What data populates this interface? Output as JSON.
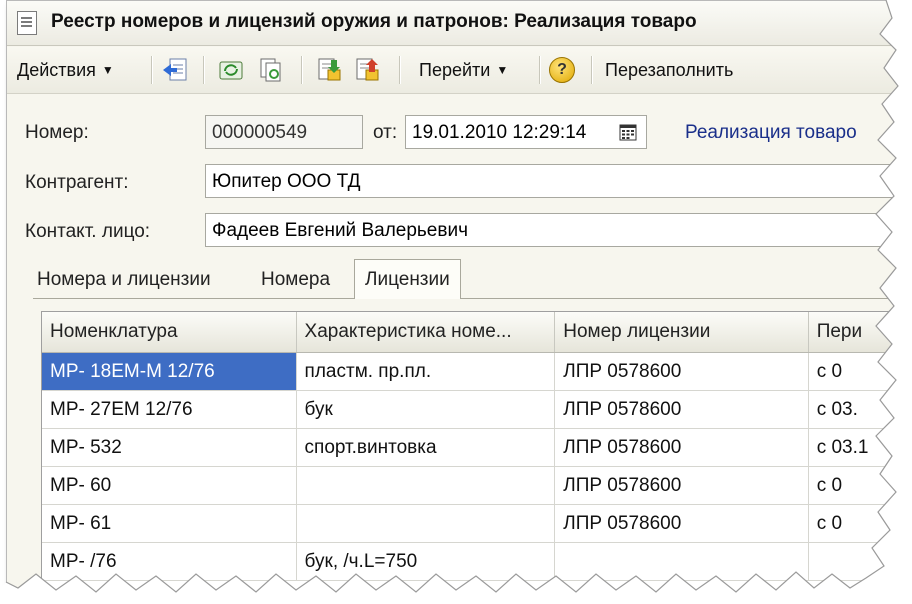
{
  "window": {
    "title": "Реестр номеров и лицензий оружия и патронов: Реализация товаро"
  },
  "toolbar": {
    "actions_label": "Действия",
    "goto_label": "Перейти",
    "refill_label": "Перезаполнить"
  },
  "form": {
    "number_label": "Номер:",
    "number_value": "000000549",
    "from_label": "от:",
    "date_value": "19.01.2010 12:29:14",
    "basis_link": "Реализация товаро",
    "counterparty_label": "Контрагент:",
    "counterparty_value": "Юпитер ООО ТД",
    "contact_label": "Контакт. лицо:",
    "contact_value": "Фадеев Евгений Валерьевич"
  },
  "tabs": [
    {
      "label": "Номера и лицензии"
    },
    {
      "label": "Номера"
    },
    {
      "label": "Лицензии"
    }
  ],
  "active_tab": "Лицензии",
  "table": {
    "columns": [
      "Номенклатура",
      "Характеристика номе...",
      "Номер лицензии",
      "Пери"
    ],
    "rows": [
      {
        "item": "МР- 18ЕМ-М 12/76",
        "characteristic": "пластм. пр.пл.",
        "license": "ЛПР 0578600",
        "period": "с 0"
      },
      {
        "item": "МР- 27ЕМ 12/76",
        "characteristic": "бук",
        "license": "ЛПР 0578600",
        "period": "с 03."
      },
      {
        "item": "МР- 532",
        "characteristic": "спорт.винтовка",
        "license": "ЛПР 0578600",
        "period": "с 03.1"
      },
      {
        "item": "МР- 60",
        "characteristic": "",
        "license": "ЛПР 0578600",
        "period": "с 0"
      },
      {
        "item": "МР- 61",
        "characteristic": "",
        "license": "ЛПР 0578600",
        "period": "с 0"
      },
      {
        "item": "МР-    /76",
        "characteristic": "бук, /ч.L=750",
        "license": "",
        "period": ""
      }
    ],
    "selected_row": 0
  }
}
